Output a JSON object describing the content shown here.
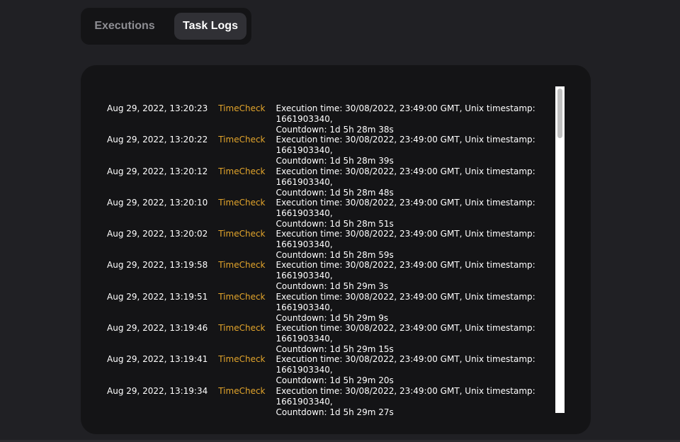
{
  "tabs": [
    {
      "label": "Executions",
      "active": false
    },
    {
      "label": "Task Logs",
      "active": true
    }
  ],
  "logs": [
    {
      "date": "Aug 29, 2022, 13:20:23",
      "task": "TimeCheck",
      "message": "Execution time: 30/08/2022, 23:49:00 GMT, Unix timestamp: 1661903340,\nCountdown: 1d 5h 28m 38s"
    },
    {
      "date": "Aug 29, 2022, 13:20:22",
      "task": "TimeCheck",
      "message": "Execution time: 30/08/2022, 23:49:00 GMT, Unix timestamp: 1661903340,\nCountdown: 1d 5h 28m 39s"
    },
    {
      "date": "Aug 29, 2022, 13:20:12",
      "task": "TimeCheck",
      "message": "Execution time: 30/08/2022, 23:49:00 GMT, Unix timestamp: 1661903340,\nCountdown: 1d 5h 28m 48s"
    },
    {
      "date": "Aug 29, 2022, 13:20:10",
      "task": "TimeCheck",
      "message": "Execution time: 30/08/2022, 23:49:00 GMT, Unix timestamp: 1661903340,\nCountdown: 1d 5h 28m 51s"
    },
    {
      "date": "Aug 29, 2022, 13:20:02",
      "task": "TimeCheck",
      "message": "Execution time: 30/08/2022, 23:49:00 GMT, Unix timestamp: 1661903340,\nCountdown: 1d 5h 28m 59s"
    },
    {
      "date": "Aug 29, 2022, 13:19:58",
      "task": "TimeCheck",
      "message": "Execution time: 30/08/2022, 23:49:00 GMT, Unix timestamp: 1661903340,\nCountdown: 1d 5h 29m 3s"
    },
    {
      "date": "Aug 29, 2022, 13:19:51",
      "task": "TimeCheck",
      "message": "Execution time: 30/08/2022, 23:49:00 GMT, Unix timestamp: 1661903340,\nCountdown: 1d 5h 29m 9s"
    },
    {
      "date": "Aug 29, 2022, 13:19:46",
      "task": "TimeCheck",
      "message": "Execution time: 30/08/2022, 23:49:00 GMT, Unix timestamp: 1661903340,\nCountdown: 1d 5h 29m 15s"
    },
    {
      "date": "Aug 29, 2022, 13:19:41",
      "task": "TimeCheck",
      "message": "Execution time: 30/08/2022, 23:49:00 GMT, Unix timestamp: 1661903340,\nCountdown: 1d 5h 29m 20s"
    },
    {
      "date": "Aug 29, 2022, 13:19:34",
      "task": "TimeCheck",
      "message": "Execution time: 30/08/2022, 23:49:00 GMT, Unix timestamp: 1661903340,\nCountdown: 1d 5h 29m 27s"
    }
  ],
  "colors": {
    "background": "#202024",
    "panel": "#141416",
    "task_accent": "#e2a42b",
    "active_tab": "#303035"
  }
}
